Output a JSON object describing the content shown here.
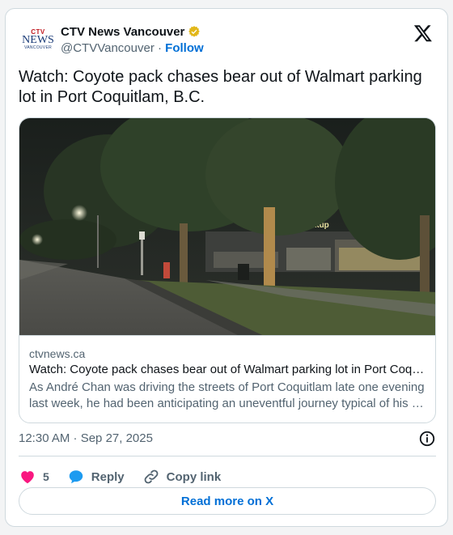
{
  "author": {
    "name": "CTV News Vancouver",
    "handle": "@CTVVancouver",
    "separator": "·",
    "follow_label": "Follow",
    "logo_top": "CTV",
    "logo_main": "NEWS",
    "logo_sub": "VANCOUVER"
  },
  "tweet": {
    "text": "Watch: Coyote pack chases bear out of Walmart parking lot in Port Coquitlam, B.C."
  },
  "link_card": {
    "domain": "ctvnews.ca",
    "title": "Watch: Coyote pack chases bear out of Walmart parking lot in Port Coquitlam, B.C.",
    "description": "As André Chan was driving the streets of Port Coquitlam late one evening last week, he had been anticipating an uneventful journey typical of his …",
    "store_sign": "Pickup"
  },
  "meta": {
    "timestamp": "12:30 AM · Sep 27, 2025"
  },
  "actions": {
    "like_count": "5",
    "reply_label": "Reply",
    "copy_link_label": "Copy link"
  },
  "footer": {
    "read_more_label": "Read more on X"
  },
  "colors": {
    "accent": "#006fd6",
    "like": "#f91880",
    "reply": "#1d9bf0",
    "verified_badge": "#e2b719"
  },
  "icons": {
    "verified": "verified-badge-icon",
    "brand": "x-logo-icon",
    "info": "info-icon",
    "like": "heart-icon",
    "reply": "reply-bubble-icon",
    "copy": "link-icon"
  }
}
